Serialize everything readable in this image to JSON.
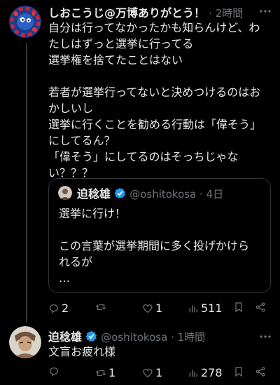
{
  "tweet": {
    "display_name": "しおこうじ@万博ありがとう！",
    "time": "· 2時間",
    "text": "自分は行ってなかったかも知らんけど、わ\nたしはずっと選挙に行ってる\n選挙権を捨てたことはない\n\n若者が選挙行ってないと決めつけるのはお\nかしいし\n選挙に行くことを勧める行動は「偉そう」\nにしてるん？\n「偉そう」にしてるのはそっちじゃな\nい？？？",
    "more_icon": "ellipsis-icon",
    "actions": {
      "reply_count": "2",
      "retweet_count": "",
      "like_count": "1",
      "view_count": "511"
    }
  },
  "quote": {
    "display_name": "迫稔雄",
    "handle_time": "@oshitokosa · 4日",
    "text": "選挙に行け！\n\nこの言葉が選挙期間に多く投げかけら\nれるが\n…"
  },
  "reply": {
    "display_name": "迫稔雄",
    "handle_time": "@oshitokosa · 1時間",
    "text": "文盲お疲れ様",
    "actions": {
      "reply_count": "",
      "retweet_count": "1",
      "like_count": "1",
      "view_count": "278"
    }
  },
  "colors": {
    "background": "#000000",
    "text": "#e7e9ea",
    "muted": "#71767b",
    "verified": "#1d9bf0",
    "border": "#2f3336"
  }
}
